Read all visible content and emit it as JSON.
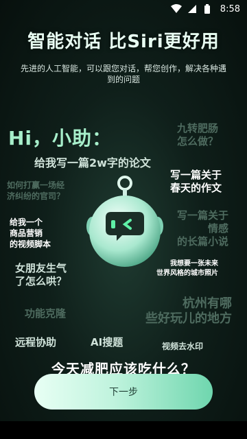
{
  "status": {
    "time": "8:58"
  },
  "header": {
    "title": "智能对话 比Siri更好用",
    "subtitle": "先进的人工智能，可以跟您对话，帮您创作，解决各种遇到的问题"
  },
  "greeting": "Hi，小助：",
  "prompts": [
    {
      "text": "九转肥肠\n怎么做？"
    },
    {
      "text": "给我写一篇2w字的论文"
    },
    {
      "text": "写一篇关于\n春天的作文"
    },
    {
      "text": "如何打赢一场经\n济纠纷的官司？"
    },
    {
      "text": "写一篇关于\n情感\n的长篇小说"
    },
    {
      "text": "给我一个\n商品营销\n的视频脚本"
    },
    {
      "text": "女朋友生气\n了怎么哄？"
    },
    {
      "text": "我想要一张未来\n世界风格的城市照片"
    },
    {
      "text": "杭州有哪\n些好玩儿的地方"
    },
    {
      "text": "功能克隆"
    },
    {
      "text": "远程协助"
    },
    {
      "text": "AI搜题"
    },
    {
      "text": "视频去水印"
    },
    {
      "text": "今天减肥应该吃什么？"
    }
  ],
  "robot": {
    "icon": "robot-chat-icon"
  },
  "next_button": {
    "label": "下一步"
  },
  "colors": {
    "accent": "#6fd6ae",
    "background": "#0f1f1a",
    "title": "#e9fff3"
  }
}
